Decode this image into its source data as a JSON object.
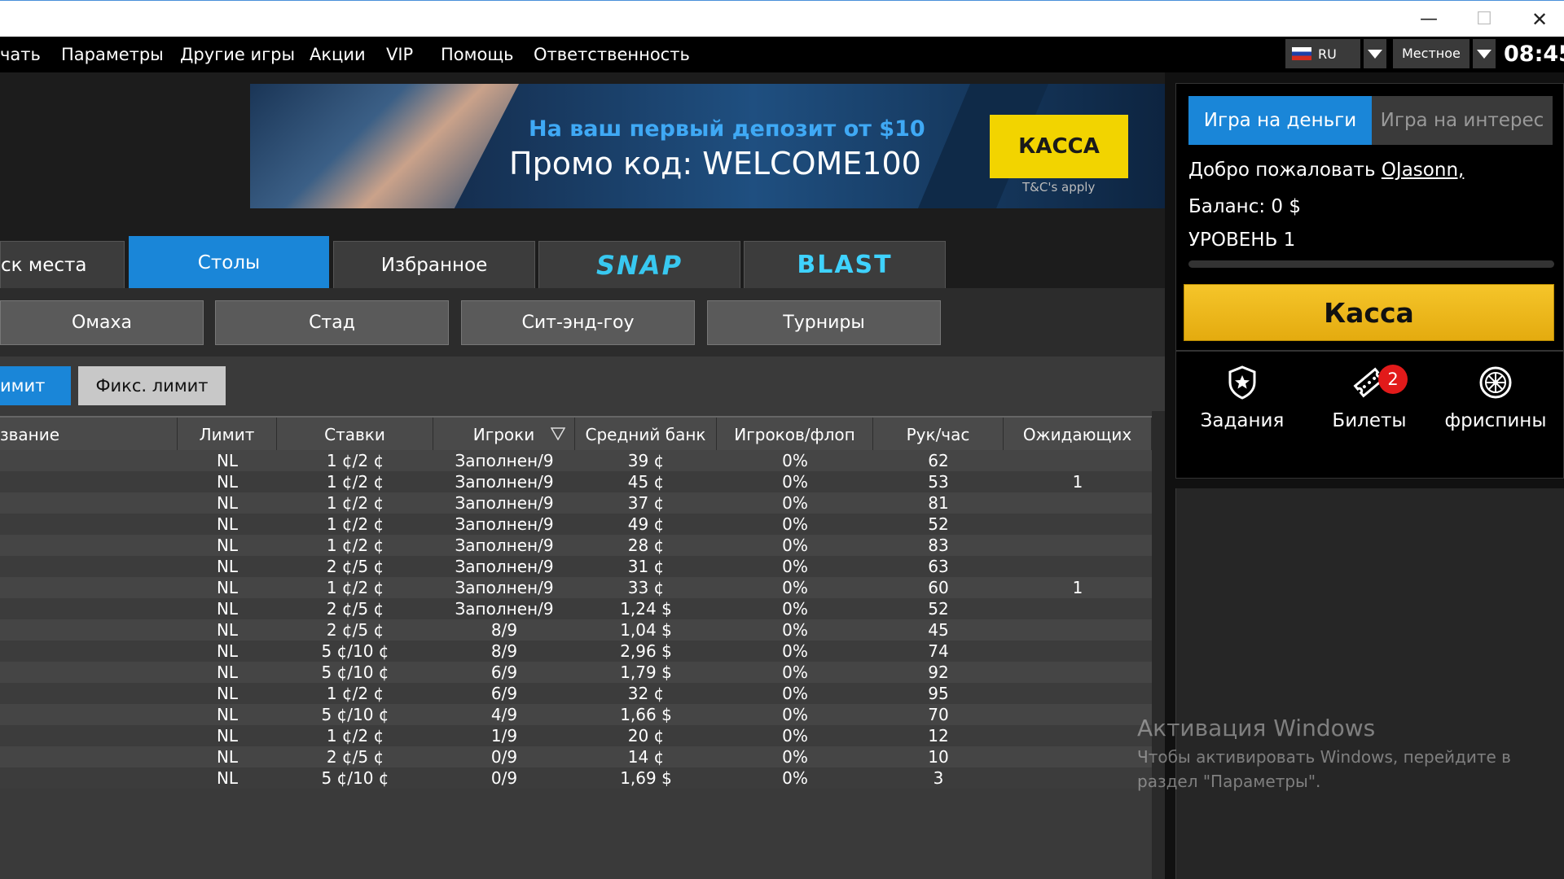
{
  "window": {
    "minimize": "—",
    "maximize": "☐",
    "close": "✕"
  },
  "menu": {
    "items": [
      "чать",
      "Параметры",
      "Другие игры",
      "Акции",
      "VIP",
      "Помощь",
      "Ответственность"
    ],
    "language": "RU",
    "timezone": "Местное",
    "time": "08:45"
  },
  "banner": {
    "line1": "На ваш первый депозит от $10",
    "line2": "Промо код: WELCOME100",
    "button": "КАССА",
    "terms": "T&C's apply"
  },
  "tabs": [
    "ск места",
    "Столы",
    "Избранное",
    "SNAP",
    "BLAST"
  ],
  "subtabs": [
    "Омаха",
    "Стад",
    "Сит-энд-гоу",
    "Турниры"
  ],
  "limit_tabs": {
    "active": "имит",
    "fixed": "Фикс. лимит"
  },
  "table": {
    "headers": [
      "звание",
      "Лимит",
      "Ставки",
      "Игроки",
      "Средний банк",
      "Игроков/флоп",
      "Рук/час",
      "Ожидающих"
    ],
    "rows": [
      [
        "",
        "NL",
        "1 ¢/2 ¢",
        "Заполнен/9",
        "39 ¢",
        "0%",
        "62",
        ""
      ],
      [
        "",
        "NL",
        "1 ¢/2 ¢",
        "Заполнен/9",
        "45 ¢",
        "0%",
        "53",
        "1"
      ],
      [
        "",
        "NL",
        "1 ¢/2 ¢",
        "Заполнен/9",
        "37 ¢",
        "0%",
        "81",
        ""
      ],
      [
        "",
        "NL",
        "1 ¢/2 ¢",
        "Заполнен/9",
        "49 ¢",
        "0%",
        "52",
        ""
      ],
      [
        "",
        "NL",
        "1 ¢/2 ¢",
        "Заполнен/9",
        "28 ¢",
        "0%",
        "83",
        ""
      ],
      [
        "",
        "NL",
        "2 ¢/5 ¢",
        "Заполнен/9",
        "31 ¢",
        "0%",
        "63",
        ""
      ],
      [
        "",
        "NL",
        "1 ¢/2 ¢",
        "Заполнен/9",
        "33 ¢",
        "0%",
        "60",
        "1"
      ],
      [
        "",
        "NL",
        "2 ¢/5 ¢",
        "Заполнен/9",
        "1,24 $",
        "0%",
        "52",
        ""
      ],
      [
        "",
        "NL",
        "2 ¢/5 ¢",
        "8/9",
        "1,04 $",
        "0%",
        "45",
        ""
      ],
      [
        "",
        "NL",
        "5 ¢/10 ¢",
        "8/9",
        "2,96 $",
        "0%",
        "74",
        ""
      ],
      [
        "",
        "NL",
        "5 ¢/10 ¢",
        "6/9",
        "1,79 $",
        "0%",
        "92",
        ""
      ],
      [
        "",
        "NL",
        "1 ¢/2 ¢",
        "6/9",
        "32 ¢",
        "0%",
        "95",
        ""
      ],
      [
        "",
        "NL",
        "5 ¢/10 ¢",
        "4/9",
        "1,66 $",
        "0%",
        "70",
        ""
      ],
      [
        "",
        "NL",
        "1 ¢/2 ¢",
        "1/9",
        "20 ¢",
        "0%",
        "12",
        ""
      ],
      [
        "",
        "NL",
        "2 ¢/5 ¢",
        "0/9",
        "14 ¢",
        "0%",
        "10",
        ""
      ],
      [
        "",
        "NL",
        "5 ¢/10 ¢",
        "0/9",
        "1,69 $",
        "0%",
        "3",
        ""
      ]
    ]
  },
  "account": {
    "tab_real": "Игра на деньги",
    "tab_play": "Игра на интерес",
    "welcome": "Добро пожаловать",
    "username": "OJasonn,",
    "balance": "Баланс: 0 $",
    "level": "УРОВЕНЬ 1",
    "level_progress": 0.0,
    "cashier": "Касса"
  },
  "features": [
    {
      "label": "Задания",
      "icon": "shield-star-icon"
    },
    {
      "label": "Билеты",
      "icon": "ticket-icon",
      "badge": "2"
    },
    {
      "label": "фриспины",
      "icon": "wheel-icon"
    }
  ],
  "watermark": {
    "title": "Активация Windows",
    "line1": "Чтобы активировать Windows, перейдите в",
    "line2": "раздел \"Параметры\"."
  },
  "colors": {
    "accent": "#1a86d8",
    "cashier": "#f5c52a",
    "badge": "#e21a1a"
  }
}
